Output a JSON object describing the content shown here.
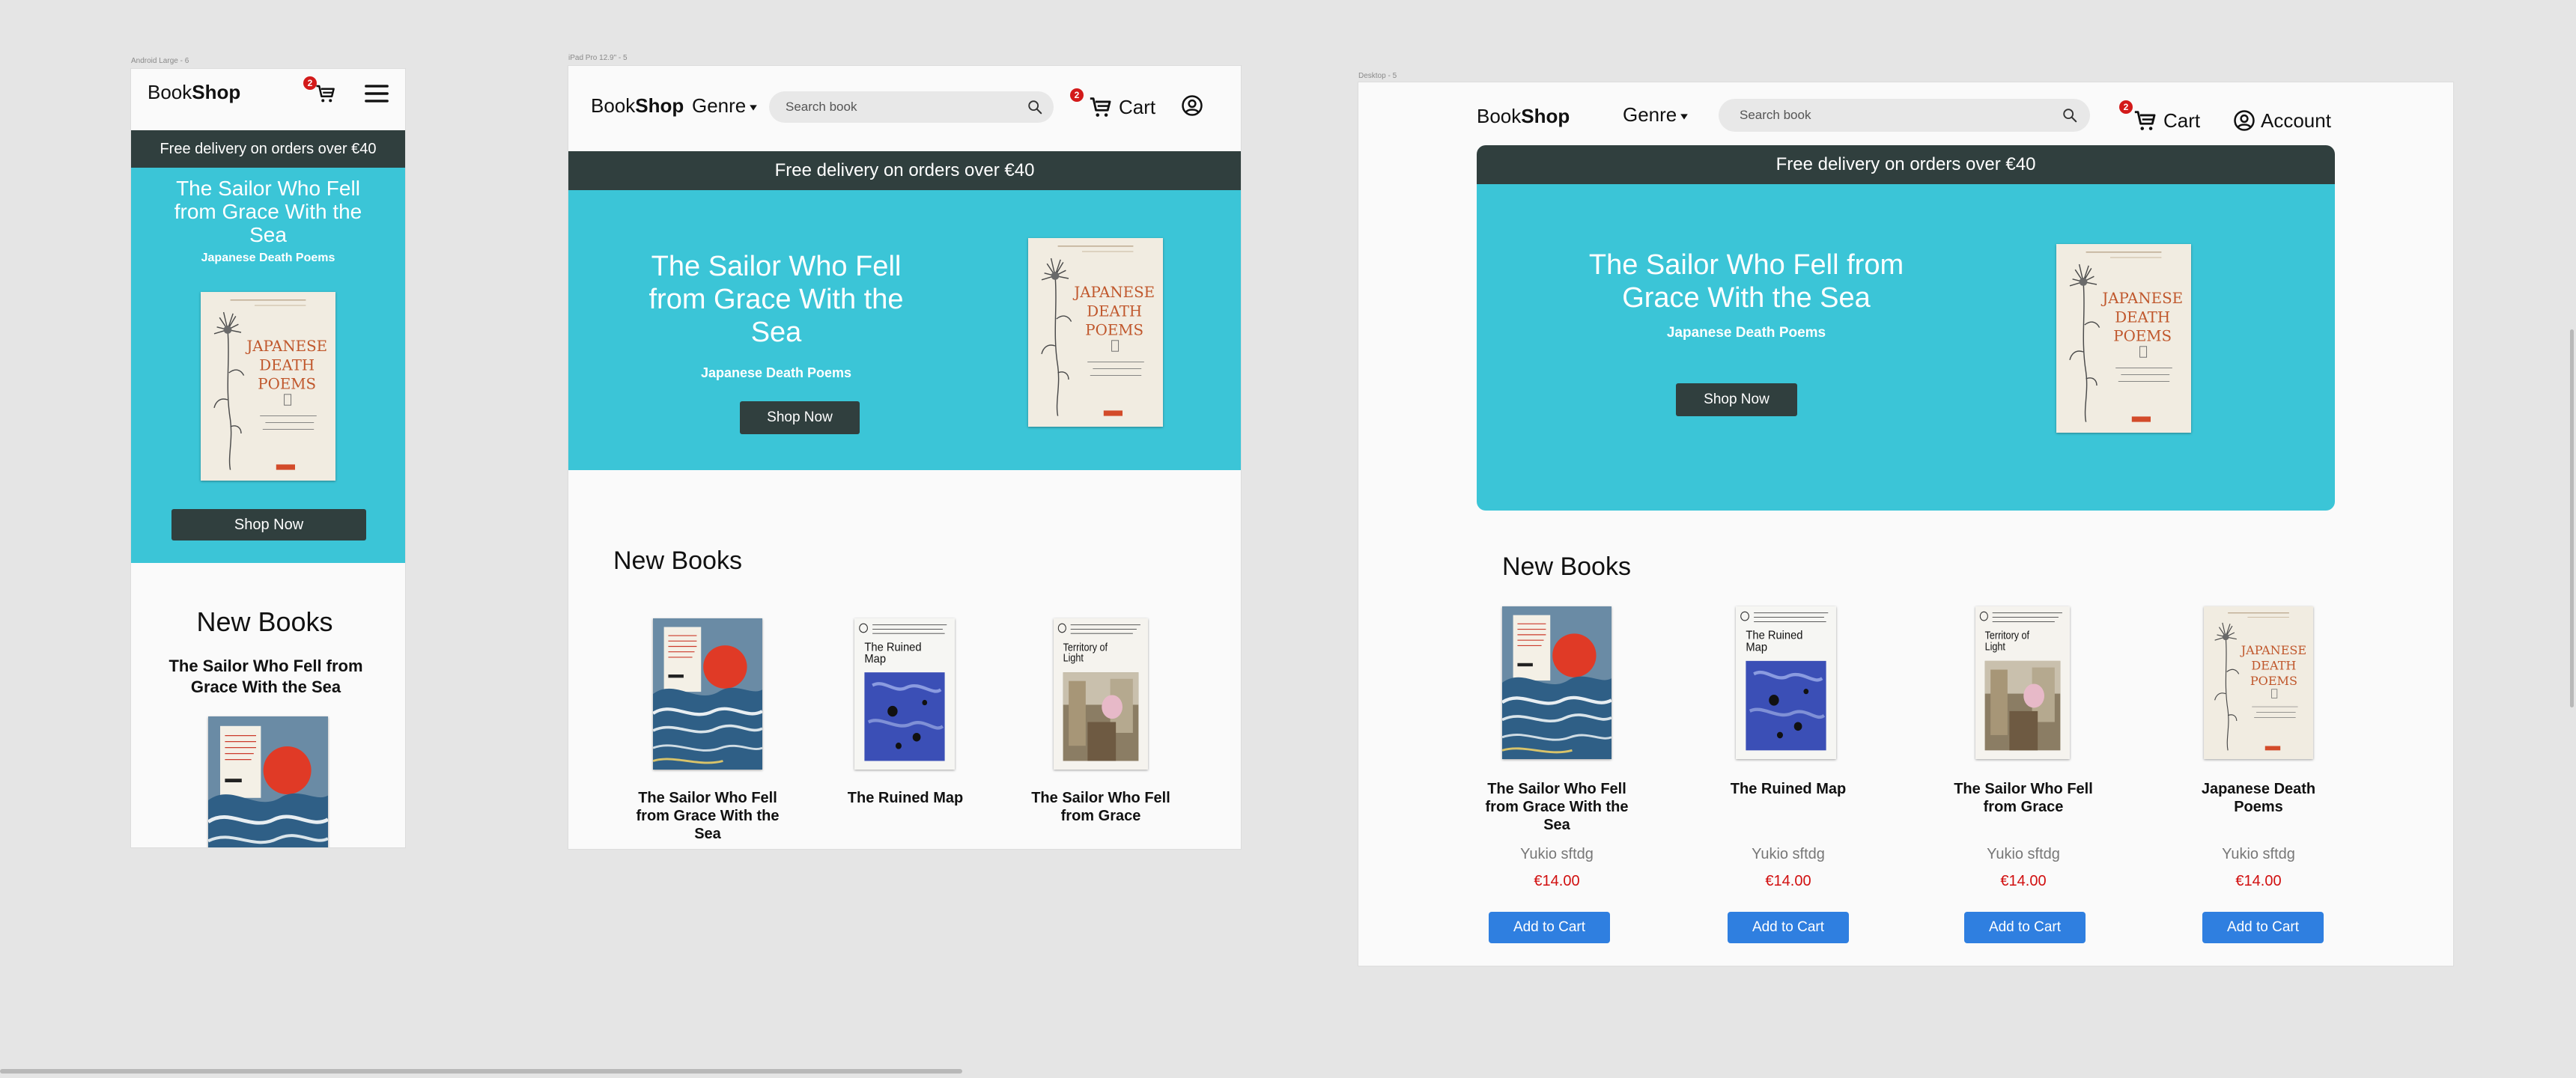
{
  "frames": {
    "mobile": {
      "label": "Android Large - 6",
      "logo_a": "Book",
      "logo_b": "Shop",
      "cart_count": "2",
      "delivery": "Free delivery on orders over €40",
      "hero_title": "The Sailor Who Fell from Grace With the Sea",
      "hero_sub": "Japanese Death Poems",
      "shop_now": "Shop Now",
      "section_title": "New Books",
      "first_book_title": "The Sailor Who Fell from Grace With the Sea"
    },
    "tablet": {
      "label": "iPad Pro 12.9\" - 5",
      "logo_a": "Book",
      "logo_b": "Shop",
      "genre": "Genre",
      "search_placeholder": "Search book",
      "cart_count": "2",
      "cart": "Cart",
      "delivery": "Free delivery on orders over €40",
      "hero_title": "The Sailor Who Fell from Grace With the Sea",
      "hero_sub": "Japanese Death Poems",
      "shop_now": "Shop Now",
      "section_title": "New Books",
      "books": [
        {
          "title": "The Sailor Who Fell from Grace With the Sea"
        },
        {
          "title": "The Ruined Map"
        },
        {
          "title": "The Sailor Who Fell from Grace"
        }
      ]
    },
    "desktop": {
      "label": "Desktop - 5",
      "logo_a": "Book",
      "logo_b": "Shop",
      "genre": "Genre",
      "search_placeholder": "Search book",
      "cart_count": "2",
      "cart": "Cart",
      "account": "Account",
      "delivery": "Free delivery on orders over €40",
      "hero_title": "The Sailor Who Fell from Grace With the Sea",
      "hero_sub": "Japanese Death Poems",
      "shop_now": "Shop Now",
      "section_title": "New Books",
      "books": [
        {
          "title": "The Sailor Who Fell from Grace With the Sea",
          "author": "Yukio sftdg",
          "price": "€14.00",
          "button": "Add to Cart",
          "cover": "sailor"
        },
        {
          "title": "The Ruined Map",
          "author": "Yukio sftdg",
          "price": "€14.00",
          "button": "Add to Cart",
          "cover": "ruined-map"
        },
        {
          "title": "The Sailor Who Fell from Grace",
          "author": "Yukio sftdg",
          "price": "€14.00",
          "button": "Add to Cart",
          "cover": "territory"
        },
        {
          "title": "Japanese Death Poems",
          "author": "Yukio sftdg",
          "price": "€14.00",
          "button": "Add to Cart",
          "cover": "death-poems"
        }
      ]
    }
  },
  "covers": {
    "death_poems": {
      "line1": "JAPANESE",
      "line2": "DEATH",
      "line3": "POEMS"
    },
    "ruined_map": {
      "title": "The Ruined Map"
    },
    "territory": {
      "title": "Territory of Light"
    }
  },
  "colors": {
    "page_bg": "#e5e5e5",
    "frame_bg": "#fafafa",
    "banner": "#303f3e",
    "hero": "#3bc5d7",
    "button_blue": "#2f7fe0",
    "price_red": "#d10f0f",
    "badge_red": "#d31a1a"
  }
}
